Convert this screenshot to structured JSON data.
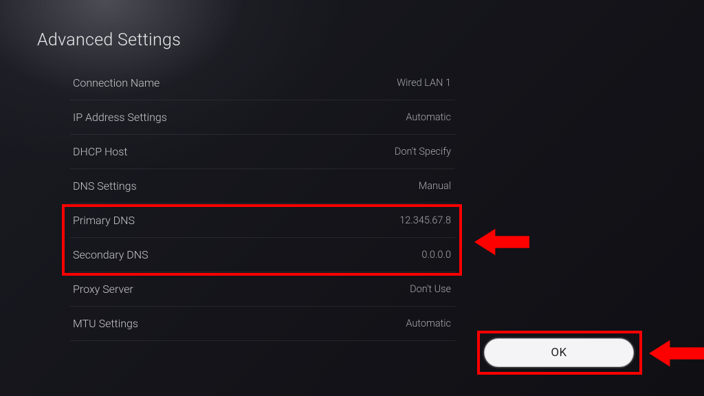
{
  "title": "Advanced Settings",
  "rows": [
    {
      "label": "Connection Name",
      "value": "Wired LAN 1"
    },
    {
      "label": "IP Address Settings",
      "value": "Automatic"
    },
    {
      "label": "DHCP Host",
      "value": "Don't Specify"
    },
    {
      "label": "DNS Settings",
      "value": "Manual"
    },
    {
      "label": "Primary DNS",
      "value": "12.345.67.8"
    },
    {
      "label": "Secondary DNS",
      "value": "0.0.0.0"
    },
    {
      "label": "Proxy Server",
      "value": "Don't Use"
    },
    {
      "label": "MTU Settings",
      "value": "Automatic"
    }
  ],
  "ok_label": "OK",
  "annotations": {
    "highlight_color": "#ff0000"
  }
}
